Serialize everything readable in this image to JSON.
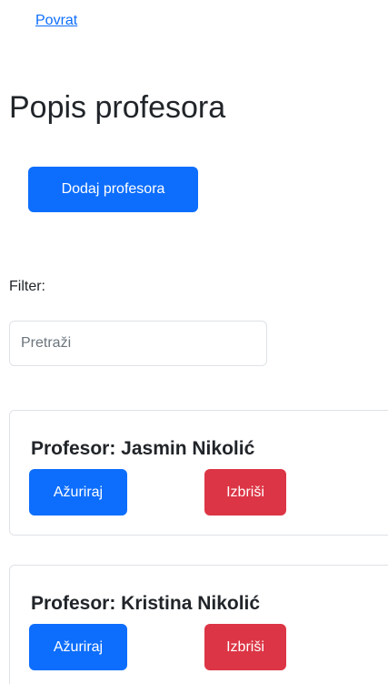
{
  "nav": {
    "back_label": "Povrat"
  },
  "header": {
    "title": "Popis profesora"
  },
  "toolbar": {
    "add_label": "Dodaj profesora"
  },
  "filter": {
    "label": "Filter:",
    "placeholder": "Pretraži",
    "value": ""
  },
  "professors": [
    {
      "title": "Profesor: Jasmin Nikolić",
      "update_label": "Ažuriraj",
      "delete_label": "Izbriši"
    },
    {
      "title": "Profesor: Kristina Nikolić",
      "update_label": "Ažuriraj",
      "delete_label": "Izbriši"
    }
  ],
  "colors": {
    "primary": "#0d6efd",
    "danger": "#dc3545",
    "border": "#dee2e6",
    "text": "#212529"
  }
}
